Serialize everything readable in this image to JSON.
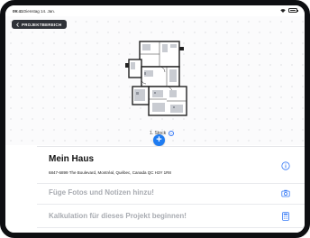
{
  "status_bar": {
    "time": "09:41",
    "date": "Dienstag 14. Jan."
  },
  "nav": {
    "back_label": "PROJEKTBEREICH"
  },
  "floor_plan": {
    "floor_label": "1. Stock"
  },
  "project": {
    "title": "Mein Haus",
    "address": "6847-6899 The Boulevard, Montréal, Québec, Canada QC H3Y 1R8"
  },
  "actions": [
    {
      "label": "Füge Fotos und Notizen hinzu!",
      "icon": "camera-icon"
    },
    {
      "label": "Kalkulation für dieses Projekt beginnen!",
      "icon": "calculator-icon"
    }
  ],
  "colors": {
    "accent": "#1f7cf2",
    "action_text": "#a8abb1",
    "frame": "#0e0f12"
  }
}
